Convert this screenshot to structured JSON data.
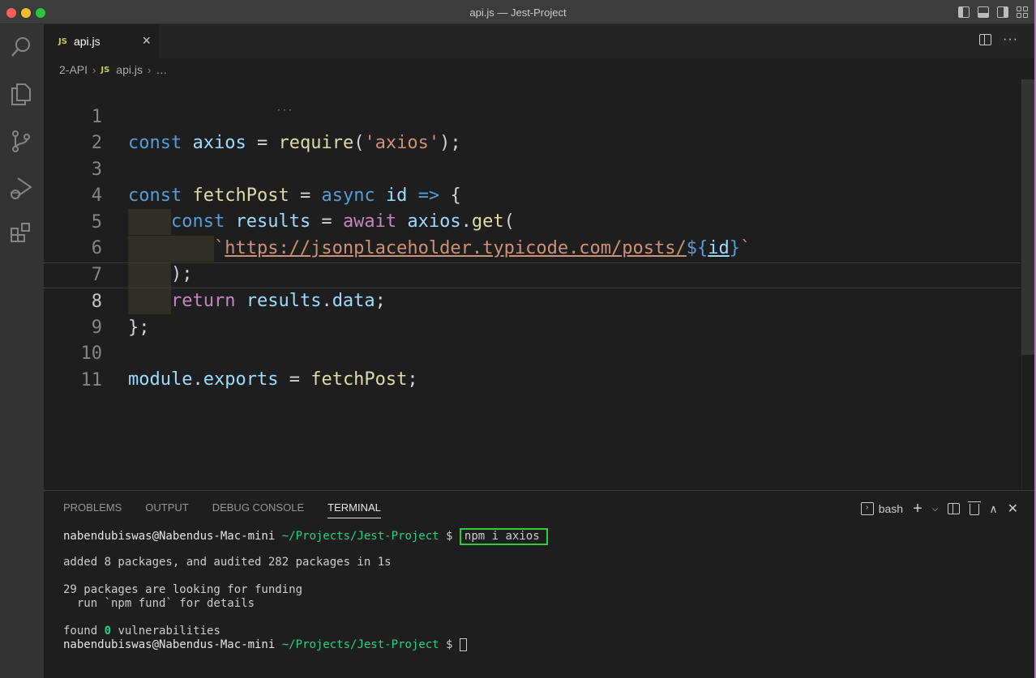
{
  "window": {
    "title": "api.js — Jest-Project"
  },
  "activity_bar": {
    "items": [
      "search-icon",
      "explorer-icon",
      "source-control-icon",
      "run-debug-icon",
      "extensions-icon"
    ]
  },
  "editor": {
    "tab": {
      "badge": "JS",
      "label": "api.js",
      "close": "×"
    },
    "breadcrumb": {
      "folder": "2-API",
      "badge": "JS",
      "file": "api.js",
      "sep": "›",
      "tail": "…"
    },
    "lines": [
      {
        "n": "1"
      },
      {
        "n": "2"
      },
      {
        "n": "3"
      },
      {
        "n": "4"
      },
      {
        "n": "5"
      },
      {
        "n": "6"
      },
      {
        "n": "7"
      },
      {
        "n": "8"
      },
      {
        "n": "9"
      },
      {
        "n": "10"
      },
      {
        "n": "11"
      }
    ],
    "tokens": {
      "const": "const",
      "axios": "axios",
      "eq": " = ",
      "require": "require",
      "lp": "(",
      "axios_str": "'axios'",
      "rp_semi": ");",
      "fetchPost": "fetchPost",
      "async": "async",
      "id": "id",
      "arrow": "=>",
      "lbrace": "{",
      "results": "results",
      "await": "await",
      "dot": ".",
      "get": "get",
      "backtick": "`",
      "url": "https://jsonplaceholder.typicode.com/posts/",
      "tpl_open": "${",
      "tpl_close": "}",
      "return": "return",
      "data": "data",
      "semi": ";",
      "rbrace_semi": "};",
      "module": "module",
      "exports": "exports"
    }
  },
  "panel": {
    "tabs": [
      "PROBLEMS",
      "OUTPUT",
      "DEBUG CONSOLE",
      "TERMINAL"
    ],
    "active_tab": "TERMINAL",
    "shell": "bash",
    "terminal": {
      "user": "nabendubiswas@Nabendus-Mac-mini",
      "path": "~/Projects/Jest-Project",
      "prompt": "$",
      "command": "npm i axios",
      "out1": "added 8 packages, and audited 282 packages in 1s",
      "out2": "29 packages are looking for funding",
      "out3": "  run `npm fund` for details",
      "found_prefix": "found ",
      "found_count": "0",
      "found_suffix": " vulnerabilities"
    }
  },
  "colors": {
    "keyword": "#569cd6",
    "variable": "#9cdcfe",
    "function": "#dcdcaa",
    "string": "#ce9178",
    "control": "#c586c0",
    "terminal_path": "#23d18b",
    "highlight_box": "#2ecc40"
  }
}
